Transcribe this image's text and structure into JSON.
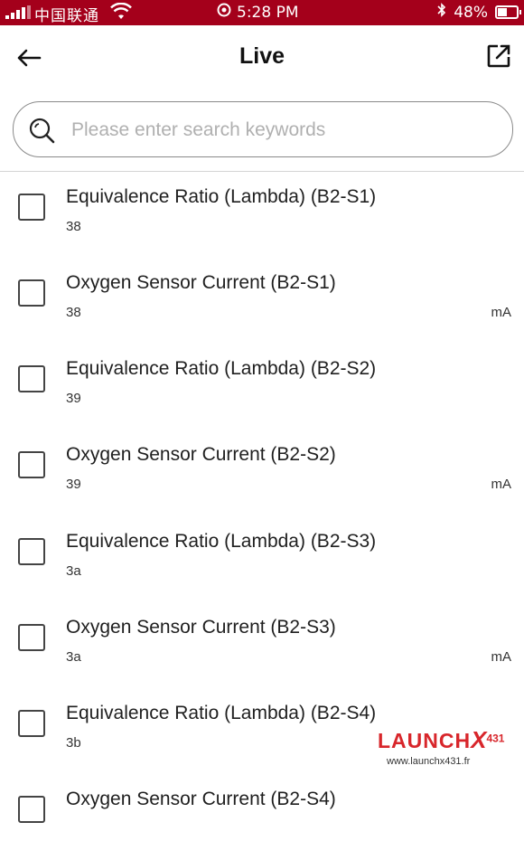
{
  "status_bar": {
    "carrier": "中国联通",
    "time": "5:28 PM",
    "battery": "48%",
    "battery_level": 0.48
  },
  "header": {
    "title": "Live",
    "back_icon": "arrow-left-icon",
    "share_icon": "external-link-icon"
  },
  "search": {
    "placeholder": "Please enter search keywords",
    "value": ""
  },
  "items": [
    {
      "name": "Equivalence Ratio (Lambda) (B2-S1)",
      "value": "38",
      "unit": ""
    },
    {
      "name": "Oxygen Sensor Current (B2-S1)",
      "value": "38",
      "unit": "mA"
    },
    {
      "name": "Equivalence Ratio (Lambda) (B2-S2)",
      "value": "39",
      "unit": ""
    },
    {
      "name": "Oxygen Sensor Current (B2-S2)",
      "value": "39",
      "unit": "mA"
    },
    {
      "name": "Equivalence Ratio (Lambda) (B2-S3)",
      "value": "3a",
      "unit": ""
    },
    {
      "name": "Oxygen Sensor Current (B2-S3)",
      "value": "3a",
      "unit": "mA"
    },
    {
      "name": "Equivalence Ratio (Lambda) (B2-S4)",
      "value": "3b",
      "unit": ""
    },
    {
      "name": "Oxygen Sensor Current (B2-S4)",
      "value": "",
      "unit": ""
    }
  ],
  "watermark": {
    "brand": "LAUNCH",
    "x": "X",
    "model": "431",
    "url": "www.launchx431.fr"
  },
  "colors": {
    "status_bar": "#a4001b",
    "watermark": "#d8262b"
  }
}
